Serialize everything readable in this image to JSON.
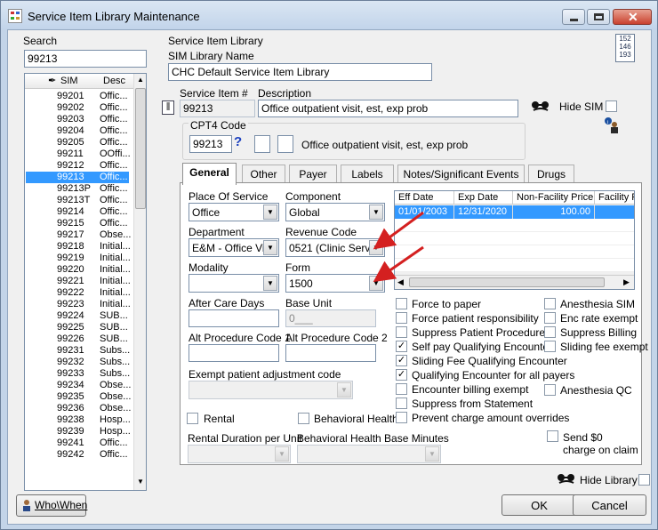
{
  "window": {
    "title": "Service Item Library Maintenance"
  },
  "search": {
    "label": "Search",
    "value": "99213"
  },
  "sim_list": {
    "headers": {
      "sim": "SIM",
      "desc": "Desc"
    },
    "rows": [
      {
        "sim": "99201",
        "desc": "Offic..."
      },
      {
        "sim": "99202",
        "desc": "Offic..."
      },
      {
        "sim": "99203",
        "desc": "Offic..."
      },
      {
        "sim": "99204",
        "desc": "Offic..."
      },
      {
        "sim": "99205",
        "desc": "Offic..."
      },
      {
        "sim": "99211",
        "desc": "OOffi..."
      },
      {
        "sim": "99212",
        "desc": "Offic..."
      },
      {
        "sim": "99213",
        "desc": "Offic...",
        "selected": true
      },
      {
        "sim": "99213P",
        "desc": "Offic..."
      },
      {
        "sim": "99213T",
        "desc": "Offic..."
      },
      {
        "sim": "99214",
        "desc": "Offic..."
      },
      {
        "sim": "99215",
        "desc": "Offic..."
      },
      {
        "sim": "99217",
        "desc": "Obse..."
      },
      {
        "sim": "99218",
        "desc": "Initial..."
      },
      {
        "sim": "99219",
        "desc": "Initial..."
      },
      {
        "sim": "99220",
        "desc": "Initial..."
      },
      {
        "sim": "99221",
        "desc": "Initial..."
      },
      {
        "sim": "99222",
        "desc": "Initial..."
      },
      {
        "sim": "99223",
        "desc": "Initial..."
      },
      {
        "sim": "99224",
        "desc": "SUB..."
      },
      {
        "sim": "99225",
        "desc": "SUB..."
      },
      {
        "sim": "99226",
        "desc": "SUB..."
      },
      {
        "sim": "99231",
        "desc": "Subs..."
      },
      {
        "sim": "99232",
        "desc": "Subs..."
      },
      {
        "sim": "99233",
        "desc": "Subs..."
      },
      {
        "sim": "99234",
        "desc": "Obse..."
      },
      {
        "sim": "99235",
        "desc": "Obse..."
      },
      {
        "sim": "99236",
        "desc": "Obse..."
      },
      {
        "sim": "99238",
        "desc": "Hosp..."
      },
      {
        "sim": "99239",
        "desc": "Hosp..."
      },
      {
        "sim": "99241",
        "desc": "Offic..."
      },
      {
        "sim": "99242",
        "desc": "Offic..."
      }
    ]
  },
  "library": {
    "group_label": "Service Item Library",
    "name_label": "SIM Library Name",
    "name_value": "CHC Default Service Item Library",
    "calendar_lines": [
      "152",
      "146",
      "193"
    ]
  },
  "service_item": {
    "number_label": "Service Item #",
    "number_value": "99213",
    "description_label": "Description",
    "description_value": "Office outpatient visit, est, exp prob",
    "hide_sim_label": "Hide SIM"
  },
  "cpt4": {
    "label": "CPT4 Code",
    "code": "99213",
    "help_glyph": "?",
    "description": "Office outpatient visit, est, exp prob"
  },
  "tabs": [
    {
      "label": "General",
      "active": true
    },
    {
      "label": "Other"
    },
    {
      "label": "Payer"
    },
    {
      "label": "Labels"
    },
    {
      "label": "Notes/Significant Events"
    },
    {
      "label": "Drugs"
    }
  ],
  "general": {
    "place_of_service": {
      "label": "Place Of Service",
      "value": "Office"
    },
    "component": {
      "label": "Component",
      "value": "Global"
    },
    "department": {
      "label": "Department",
      "value": "E&M - Office Vi"
    },
    "revenue_code": {
      "label": "Revenue Code",
      "value": "0521 (Clinic Servi"
    },
    "modality": {
      "label": "Modality",
      "value": ""
    },
    "form": {
      "label": "Form",
      "value": "1500"
    },
    "after_care_days": {
      "label": "After Care Days",
      "value": ""
    },
    "base_unit": {
      "label": "Base Unit",
      "value": "0___"
    },
    "alt_code_1": {
      "label": "Alt Procedure Code 1",
      "value": ""
    },
    "alt_code_2": {
      "label": "Alt Procedure Code 2",
      "value": ""
    },
    "exempt_adjustment": {
      "label": "Exempt patient adjustment code",
      "value": ""
    },
    "rental_label": "Rental",
    "behavioral_health_label": "Behavioral Health",
    "rental_duration_label": "Rental Duration per Unit",
    "bh_base_minutes_label": "Behavioral Health Base Minutes"
  },
  "fee_grid": {
    "headers": [
      "Eff Date",
      "Exp Date",
      "Non-Facility Price",
      "Facility P"
    ],
    "rows": [
      {
        "eff": "01/01/2003",
        "exp": "12/31/2020",
        "price": "100.00",
        "facility": ""
      }
    ]
  },
  "checkboxes_left": [
    {
      "label": "Force to paper",
      "checked": false
    },
    {
      "label": "Force patient responsibility",
      "checked": false
    },
    {
      "label": "Suppress Patient Procedure",
      "checked": false
    },
    {
      "label": "Self pay Qualifying Encounter",
      "checked": true
    },
    {
      "label": "Sliding Fee Qualifying Encounter",
      "checked": true
    },
    {
      "label": "Qualifying Encounter for all payers",
      "checked": true
    },
    {
      "label": "Encounter billing exempt",
      "checked": false
    },
    {
      "label": "Suppress from Statement",
      "checked": false
    },
    {
      "label": "Prevent charge amount overrides",
      "checked": false
    }
  ],
  "checkboxes_right": [
    {
      "label": "Anesthesia SIM",
      "checked": false
    },
    {
      "label": "Enc rate exempt",
      "checked": false
    },
    {
      "label": "Suppress Billing",
      "checked": false
    },
    {
      "label": "Sliding fee exempt",
      "checked": false
    },
    {
      "label": "Anesthesia QC",
      "checked": false
    }
  ],
  "send_zero": {
    "line1": "Send $0",
    "line2": "charge on claim"
  },
  "footer": {
    "hide_library_label": "Hide Library",
    "whowhen_label": "Who\\When",
    "ok_label": "OK",
    "cancel_label": "Cancel"
  },
  "colors": {
    "selection": "#3399ff",
    "arrow": "#d42020",
    "titlebar": "#c2d4ea"
  }
}
